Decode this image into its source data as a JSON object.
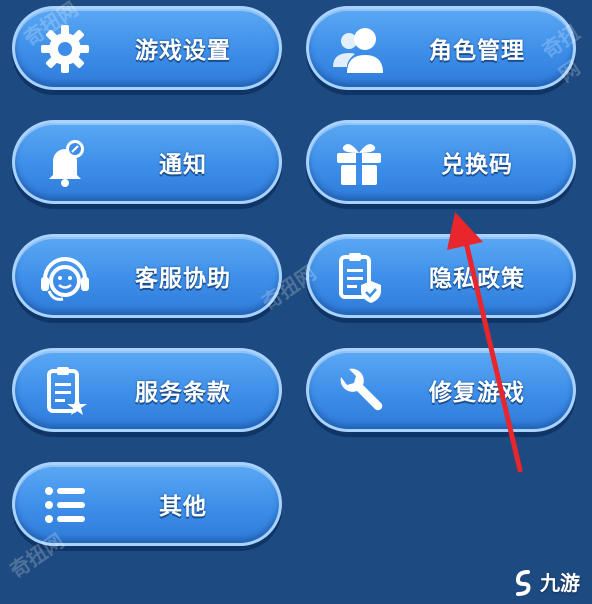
{
  "menu": {
    "left": [
      {
        "label": "游戏设置",
        "icon": "gear-icon"
      },
      {
        "label": "通知",
        "icon": "bell-icon"
      },
      {
        "label": "客服协助",
        "icon": "support-headset-icon"
      },
      {
        "label": "服务条款",
        "icon": "clipboard-star-icon"
      },
      {
        "label": "其他",
        "icon": "list-icon"
      }
    ],
    "right": [
      {
        "label": "角色管理",
        "icon": "users-icon"
      },
      {
        "label": "兑换码",
        "icon": "gift-icon"
      },
      {
        "label": "隐私政策",
        "icon": "clipboard-shield-icon"
      },
      {
        "label": "修复游戏",
        "icon": "wrench-icon"
      }
    ]
  },
  "watermarks": [
    "奇扭网",
    "奇扭网",
    "奇扭网",
    "奇扭网"
  ],
  "brand": {
    "text": "九游"
  },
  "colors": {
    "background": "#1d4a80",
    "button": "#3d8ee9",
    "button_border": "#a9d2ff",
    "arrow": "#e8262b"
  }
}
